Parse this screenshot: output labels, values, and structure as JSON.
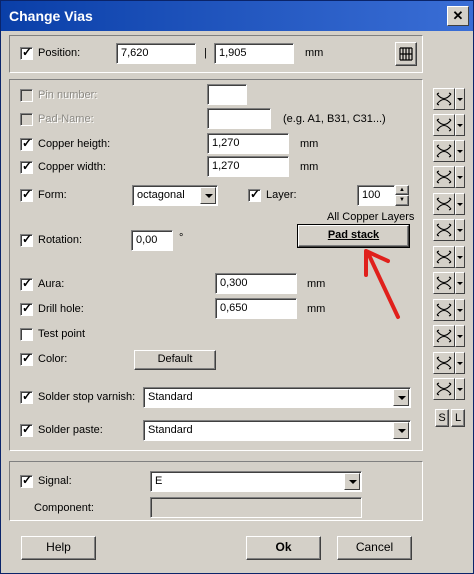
{
  "window": {
    "title": "Change Vias",
    "close_glyph": "✕"
  },
  "position": {
    "label": "Position:",
    "x": "7,620",
    "separator": "|",
    "y": "1,905",
    "unit": "mm",
    "checked": true,
    "grid_icon": "grid-icon"
  },
  "fields": {
    "pin_number": {
      "label": "Pin number:",
      "value": ""
    },
    "pad_name": {
      "label": "Pad-Name:",
      "value": "",
      "hint": "(e.g. A1, B31, C31...)"
    },
    "copper_height": {
      "label": "Copper heigth:",
      "value": "1,270",
      "unit": "mm"
    },
    "copper_width": {
      "label": "Copper width:",
      "value": "1,270",
      "unit": "mm"
    },
    "form": {
      "label": "Form:",
      "value": "octagonal"
    },
    "layer": {
      "label": "Layer:",
      "value": "100",
      "caption": "All Copper Layers"
    },
    "pad_stack": {
      "label": "Pad stack"
    },
    "rotation": {
      "label": "Rotation:",
      "value": "0,00",
      "unit": "°"
    },
    "aura": {
      "label": "Aura:",
      "value": "0,300",
      "unit": "mm"
    },
    "drill_hole": {
      "label": "Drill hole:",
      "value": "0,650",
      "unit": "mm"
    },
    "test_point": {
      "label": "Test point"
    },
    "color": {
      "label": "Color:",
      "button": "Default"
    },
    "solder_stop": {
      "label": "Solder stop varnish:",
      "value": "Standard"
    },
    "solder_paste": {
      "label": "Solder paste:",
      "value": "Standard"
    }
  },
  "signal": {
    "label": "Signal:",
    "value": "E",
    "component_label": "Component:",
    "component_value": ""
  },
  "side_buttons": {
    "s_label": "S",
    "l_label": "L"
  },
  "footer": {
    "help_label": "Help",
    "ok_label": "Ok",
    "cancel_label": "Cancel"
  },
  "colors": {
    "title_bar": "#0a3fa8",
    "arrow": "#e0201c",
    "face": "#d4d0c8"
  }
}
